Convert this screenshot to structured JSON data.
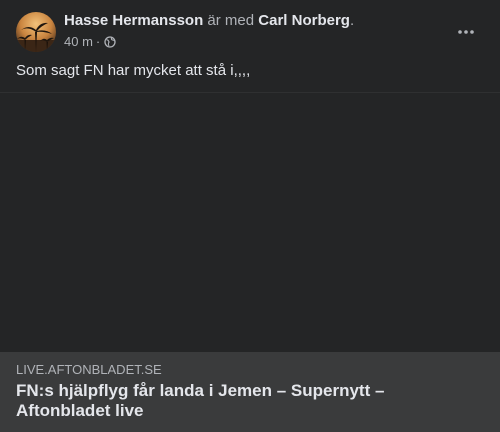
{
  "post": {
    "author": "Hasse Hermansson",
    "with_text": " är med ",
    "tagged": "Carl Norberg",
    "period": ".",
    "timestamp": "40 m",
    "separator": "·",
    "audience_icon": "globe-icon",
    "more_icon": "more-options-icon",
    "text": "Som sagt FN har mycket att stå i,,,,"
  },
  "link": {
    "domain": "LIVE.AFTONBLADET.SE",
    "title": "FN:s hjälpflyg får landa i Jemen – Supernytt – Aftonbladet live"
  },
  "colors": {
    "background": "#242526",
    "link_card": "#3a3b3c",
    "text_primary": "#e4e6eb",
    "text_secondary": "#b0b3b8"
  }
}
